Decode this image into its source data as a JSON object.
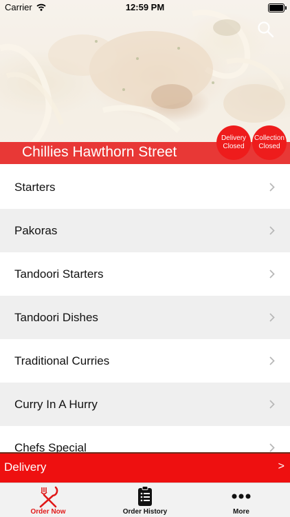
{
  "status_bar": {
    "carrier": "Carrier",
    "time": "12:59 PM"
  },
  "restaurant": {
    "name": "Chillies Hawthorn Street",
    "delivery_status": {
      "line1": "Delivery",
      "line2": "Closed"
    },
    "collection_status": {
      "line1": "Collection",
      "line2": "Closed"
    }
  },
  "categories": [
    {
      "label": "Starters"
    },
    {
      "label": "Pakoras"
    },
    {
      "label": "Tandoori Starters"
    },
    {
      "label": "Tandoori Dishes"
    },
    {
      "label": "Traditional Curries"
    },
    {
      "label": "Curry In A Hurry"
    },
    {
      "label": "Chefs Special"
    }
  ],
  "delivery_bar": {
    "label": "Delivery",
    "arrow": ">"
  },
  "tabs": [
    {
      "label": "Order Now",
      "icon": "fork-knife-icon",
      "active": true
    },
    {
      "label": "Order History",
      "icon": "clipboard-list-icon",
      "active": false
    },
    {
      "label": "More",
      "icon": "more-dots-icon",
      "active": false
    }
  ],
  "colors": {
    "brand_red": "#ee1010",
    "active_tab": "#e01818",
    "inactive_tab": "#111111"
  }
}
